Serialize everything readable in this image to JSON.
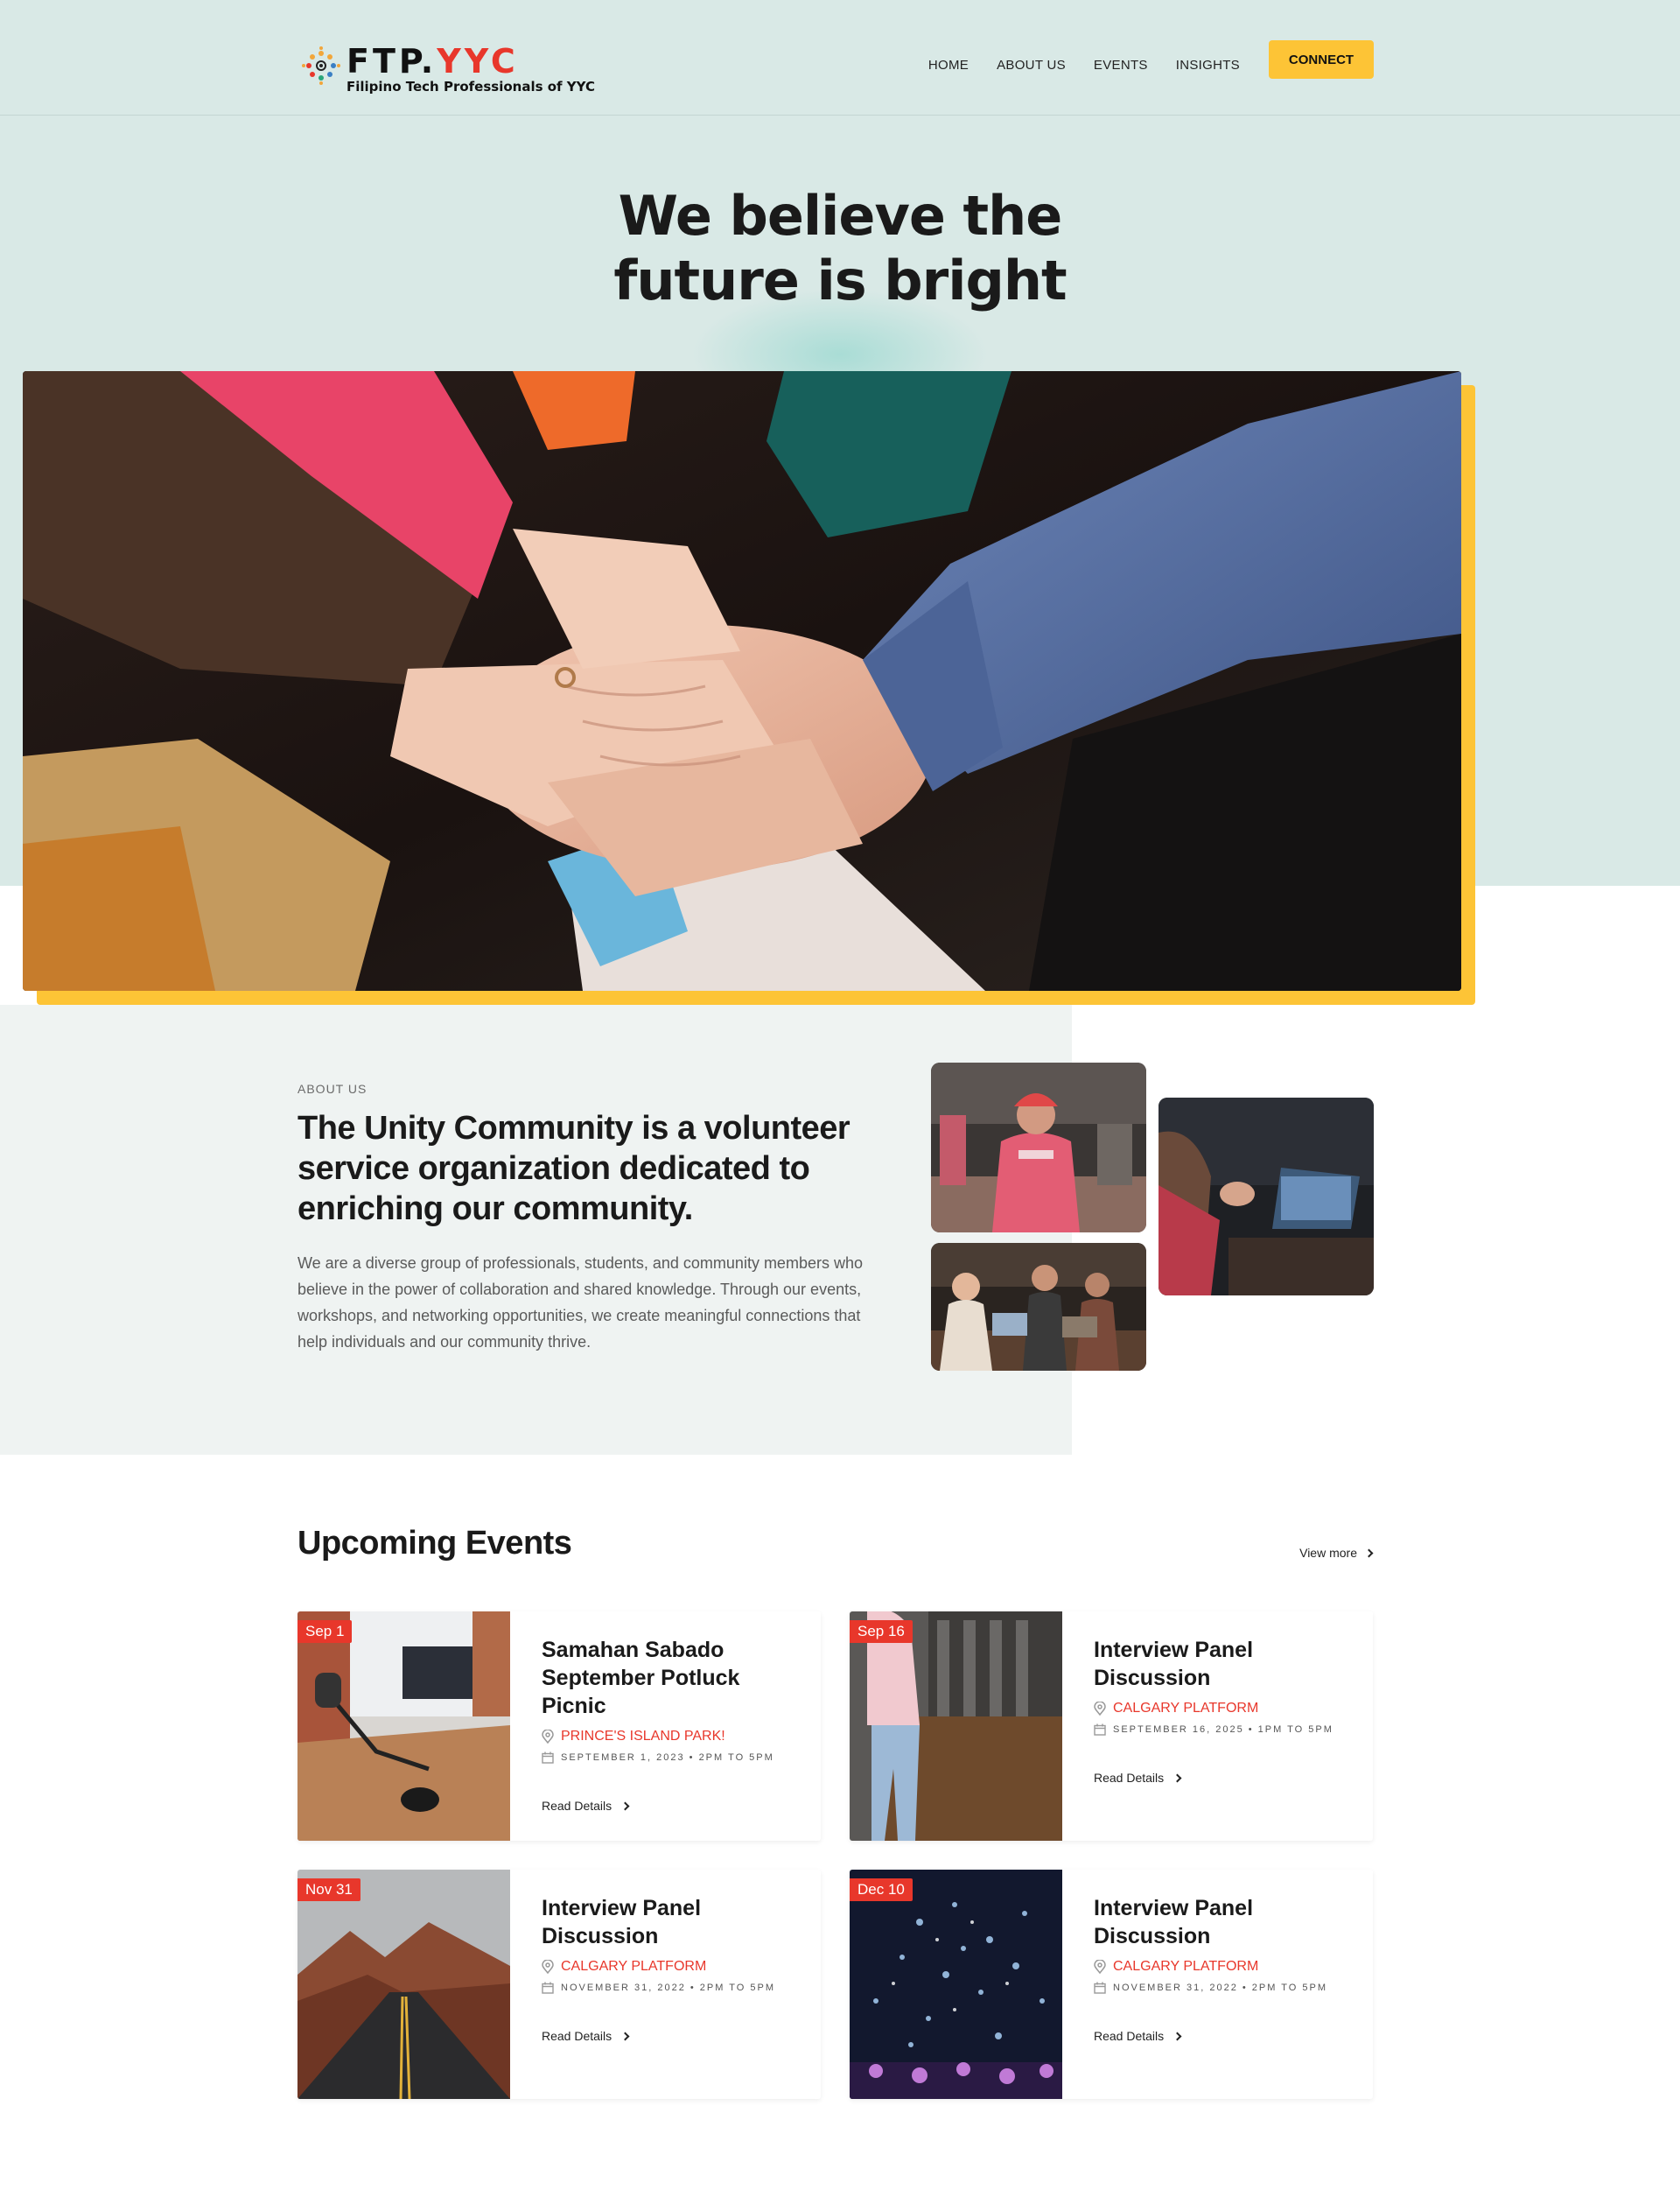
{
  "brand": {
    "name_ftp": "FTP",
    "name_dot": ".",
    "name_yyc": "YYC",
    "tagline": "Filipino Tech Professionals of YYC",
    "accent": "#e8372b",
    "yellow": "#fdc436",
    "teal": "#d9e9e6"
  },
  "nav": {
    "items": [
      "HOME",
      "ABOUT US",
      "EVENTS",
      "INSIGHTS"
    ],
    "cta": "CONNECT"
  },
  "hero": {
    "line1": "We believe the",
    "line2": "future is bright"
  },
  "about": {
    "eyebrow": "ABOUT US",
    "heading": "The Unity Community is a volunteer service organization dedicated to enriching our community.",
    "body": "We are a diverse group of professionals, students, and community members who believe in the power of collaboration and shared knowledge. Through our events, workshops, and networking opportunities, we create meaningful connections that help individuals and our community thrive."
  },
  "events": {
    "title": "Upcoming Events",
    "view_more": "View more",
    "items": [
      {
        "date": "Sep 1",
        "title": "Samahan Sabado September Potluck Picnic",
        "location": "PRINCE'S ISLAND PARK!",
        "when": "SEPTEMBER 1, 2023 • 2PM TO 5PM",
        "read": "Read Details"
      },
      {
        "date": "Sep 16",
        "title": "Interview Panel Discussion",
        "location": "CALGARY PLATFORM",
        "when": "SEPTEMBER 16, 2025 • 1PM TO 5PM",
        "read": "Read Details"
      },
      {
        "date": "Nov 31",
        "title": "Interview Panel Discussion",
        "location": "CALGARY PLATFORM",
        "when": "NOVEMBER 31, 2022 • 2PM TO 5PM",
        "read": "Read Details"
      },
      {
        "date": "Dec 10",
        "title": "Interview Panel Discussion",
        "location": "CALGARY PLATFORM",
        "when": "NOVEMBER 31, 2022 • 2PM TO 5PM",
        "read": "Read Details"
      }
    ]
  }
}
